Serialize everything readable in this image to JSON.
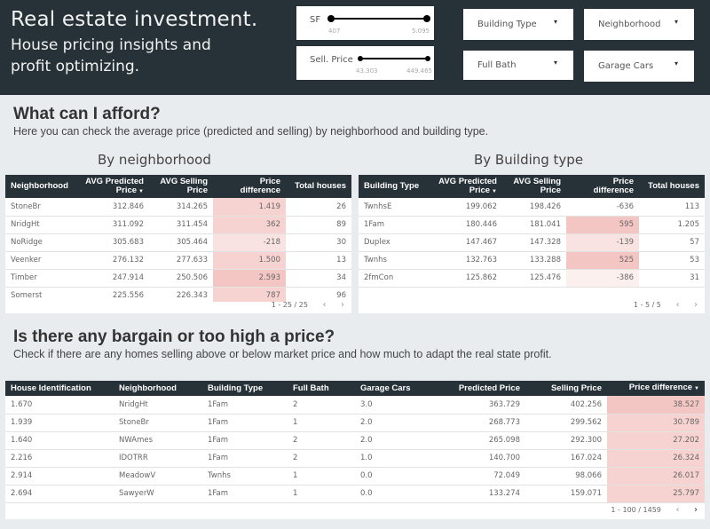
{
  "header": {
    "title": "Real estate investment.",
    "subtitle_line1": "House pricing insights and",
    "subtitle_line2": "profit optimizing."
  },
  "filters": {
    "sliders": [
      {
        "label": "SF",
        "min": "407",
        "max": "5.095"
      },
      {
        "label": "Sell. Price",
        "min": "43.303",
        "max": "449.465"
      }
    ],
    "dropdowns": [
      {
        "label": "Building Type"
      },
      {
        "label": "Neighborhood"
      },
      {
        "label": "Full Bath"
      },
      {
        "label": "Garage Cars"
      }
    ],
    "caret": "▾"
  },
  "afford": {
    "title": "What can I afford?",
    "description": "Here you can check the average price (predicted and selling) by neighborhood and building type.",
    "by_neighborhood": {
      "title": "By neighborhood",
      "columns": [
        "Neighborhood",
        "AVG Predicted Price",
        "AVG Selling Price",
        "Price difference",
        "Total houses"
      ],
      "rows": [
        [
          "StoneBr",
          "312.846",
          "314.265",
          "1.419",
          "26"
        ],
        [
          "NridgHt",
          "311.092",
          "311.454",
          "362",
          "89"
        ],
        [
          "NoRidge",
          "305.683",
          "305.464",
          "-218",
          "30"
        ],
        [
          "Veenker",
          "276.132",
          "277.633",
          "1.500",
          "13"
        ],
        [
          "Timber",
          "247.914",
          "250.506",
          "2.593",
          "34"
        ],
        [
          "Somerst",
          "225.556",
          "226.343",
          "787",
          "96"
        ]
      ],
      "pagination": "1 - 25 / 25"
    },
    "by_building": {
      "title": "By Building type",
      "columns": [
        "Building Type",
        "AVG Predicted Price",
        "AVG Selling Price",
        "Price difference",
        "Total houses"
      ],
      "rows": [
        [
          "TwnhsE",
          "199.062",
          "198.426",
          "-636",
          "113"
        ],
        [
          "1Fam",
          "180.446",
          "181.041",
          "595",
          "1.205"
        ],
        [
          "Duplex",
          "147.467",
          "147.328",
          "-139",
          "57"
        ],
        [
          "Twnhs",
          "132.763",
          "133.288",
          "525",
          "53"
        ],
        [
          "2fmCon",
          "125.862",
          "125.476",
          "-386",
          "31"
        ]
      ],
      "pagination": "1 - 5 / 5"
    }
  },
  "bargain": {
    "title": "Is there any bargain or too high a price?",
    "description": "Check if there are any homes selling above or below market price and how much to adapt the real state profit.",
    "columns": [
      "House Identification",
      "Neighborhood",
      "Building Type",
      "Full Bath",
      "Garage Cars",
      "Predicted Price",
      "Selling Price",
      "Price difference"
    ],
    "rows": [
      [
        "1.670",
        "NridgHt",
        "1Fam",
        "2",
        "3.0",
        "363.729",
        "402.256",
        "38.527"
      ],
      [
        "1.939",
        "StoneBr",
        "1Fam",
        "1",
        "2.0",
        "268.773",
        "299.562",
        "30.789"
      ],
      [
        "1.640",
        "NWAmes",
        "1Fam",
        "2",
        "2.0",
        "265.098",
        "292.300",
        "27.202"
      ],
      [
        "2.216",
        "IDOTRR",
        "1Fam",
        "2",
        "1.0",
        "140.700",
        "167.024",
        "26.324"
      ],
      [
        "2.914",
        "MeadowV",
        "Twnhs",
        "1",
        "0.0",
        "72.049",
        "98.066",
        "26.017"
      ],
      [
        "2.694",
        "SawyerW",
        "1Fam",
        "1",
        "0.0",
        "133.274",
        "159.071",
        "25.797"
      ]
    ],
    "pagination": "1 - 100 / 1459"
  },
  "pager_icons": {
    "prev": "‹",
    "next": "›"
  },
  "sort_icon": "▼",
  "colors": {
    "header_bg": "#263238",
    "diff_strong": "#f4c6c3",
    "diff_mid": "#f6d3d1",
    "diff_light": "#f9e3e2",
    "diff_faint": "#fcf0ef"
  }
}
